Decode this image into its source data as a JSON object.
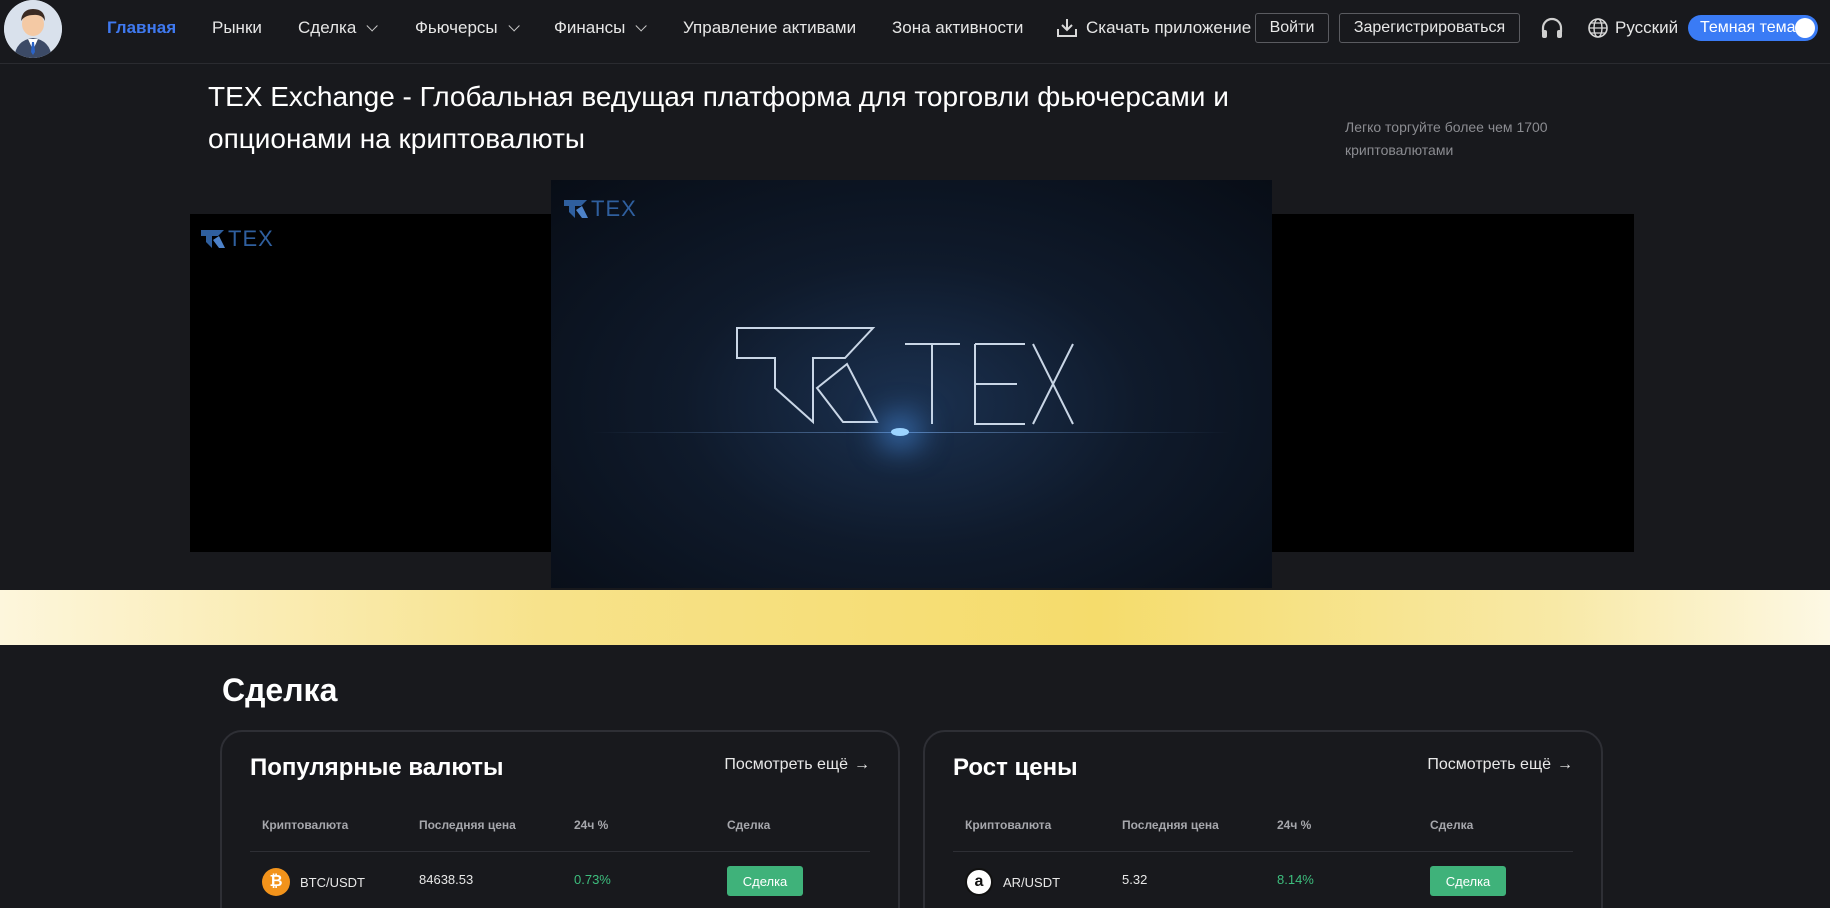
{
  "nav": {
    "items": [
      {
        "label": "Главная",
        "active": true
      },
      {
        "label": "Рынки"
      },
      {
        "label": "Сделка",
        "dropdown": true
      },
      {
        "label": "Фьючерсы",
        "dropdown": true
      },
      {
        "label": "Финансы",
        "dropdown": true
      },
      {
        "label": "Управление активами"
      },
      {
        "label": "Зона активности"
      }
    ],
    "download_label": "Скачать приложение",
    "login_label": "Войти",
    "register_label": "Зарегистрироваться",
    "language_label": "Русский",
    "theme_label": "Темная тема",
    "accent_color": "#3f79f0"
  },
  "hero": {
    "title": "TEX Exchange - Глобальная ведущая платформа для торговли фьючерсами и опционами на криптовалюты",
    "subtitle": "Легко торгуйте более чем 1700 криптовалютами",
    "logo_text": "TEX"
  },
  "trade": {
    "section_title": "Сделка",
    "columns": {
      "coin": "Криптовалюта",
      "price": "Последняя цена",
      "change": "24ч %",
      "action": "Сделка"
    },
    "more_label": "Посмотреть ещё",
    "popular": {
      "title": "Популярные валюты",
      "rows": [
        {
          "icon": "bitcoin-icon",
          "pair": "BTC/USDT",
          "price": "84638.53",
          "change": "0.73%",
          "action": "Сделка"
        }
      ]
    },
    "gainers": {
      "title": "Рост цены",
      "rows": [
        {
          "icon": "arweave-icon",
          "pair": "AR/USDT",
          "price": "5.32",
          "change": "8.14%",
          "action": "Сделка"
        }
      ]
    },
    "positive_color": "#3dbd7d",
    "button_color": "#3fb27a"
  }
}
